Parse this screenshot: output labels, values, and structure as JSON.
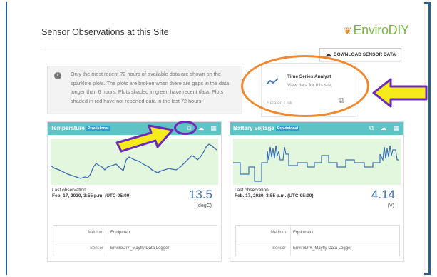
{
  "page": {
    "title": "Sensor Observations at this Site"
  },
  "logo": {
    "text": "EnviroDIY"
  },
  "download_button": {
    "label": "DOWNLOAD SENSOR DATA",
    "icon": "cloud-download-icon"
  },
  "notice": {
    "icon": "info-icon",
    "text": "Only the most recent 72 hours of available data are shown on the sparkline plots. The plots are broken when there are gaps in the data longer than 6 hours. Plots shaded in green have recent data. Plots shaded in red have not reported data in the last 72 hours."
  },
  "related_link": {
    "title": "Time Series Analyst",
    "subtitle": "View data for this site.",
    "footer": "Related Link",
    "icon": "external-link-icon"
  },
  "cards": [
    {
      "name": "Temperature",
      "badge": "Provisional",
      "last_obs_label": "Last observation",
      "last_obs_time": "Feb. 17, 2020, 3:55 p.m. (UTC-05:00)",
      "value": "13.5",
      "unit": "(degC)",
      "medium_label": "Medium",
      "medium": "Equipment",
      "sensor_label": "Sensor",
      "sensor": "EnviroDIY_Mayfly Data Logger"
    },
    {
      "name": "Battery voltage",
      "badge": "Provisional",
      "last_obs_label": "Last observation",
      "last_obs_time": "Feb. 17, 2020, 3:55 p.m. (UTC-05:00)",
      "value": "4.14",
      "unit": "(V)",
      "medium_label": "Medium",
      "medium": "Equipment",
      "sensor_label": "Sensor",
      "sensor": "EnviroDIY_Mayfly Data Logger"
    }
  ],
  "colors": {
    "accent": "#5ec3c4",
    "plot_fill": "#e3f7df",
    "plot_line": "#3b6fb0",
    "annotation_orange": "#f0892e",
    "annotation_arrow": "#f5ea1c",
    "annotation_purple": "#6a2bb8"
  }
}
